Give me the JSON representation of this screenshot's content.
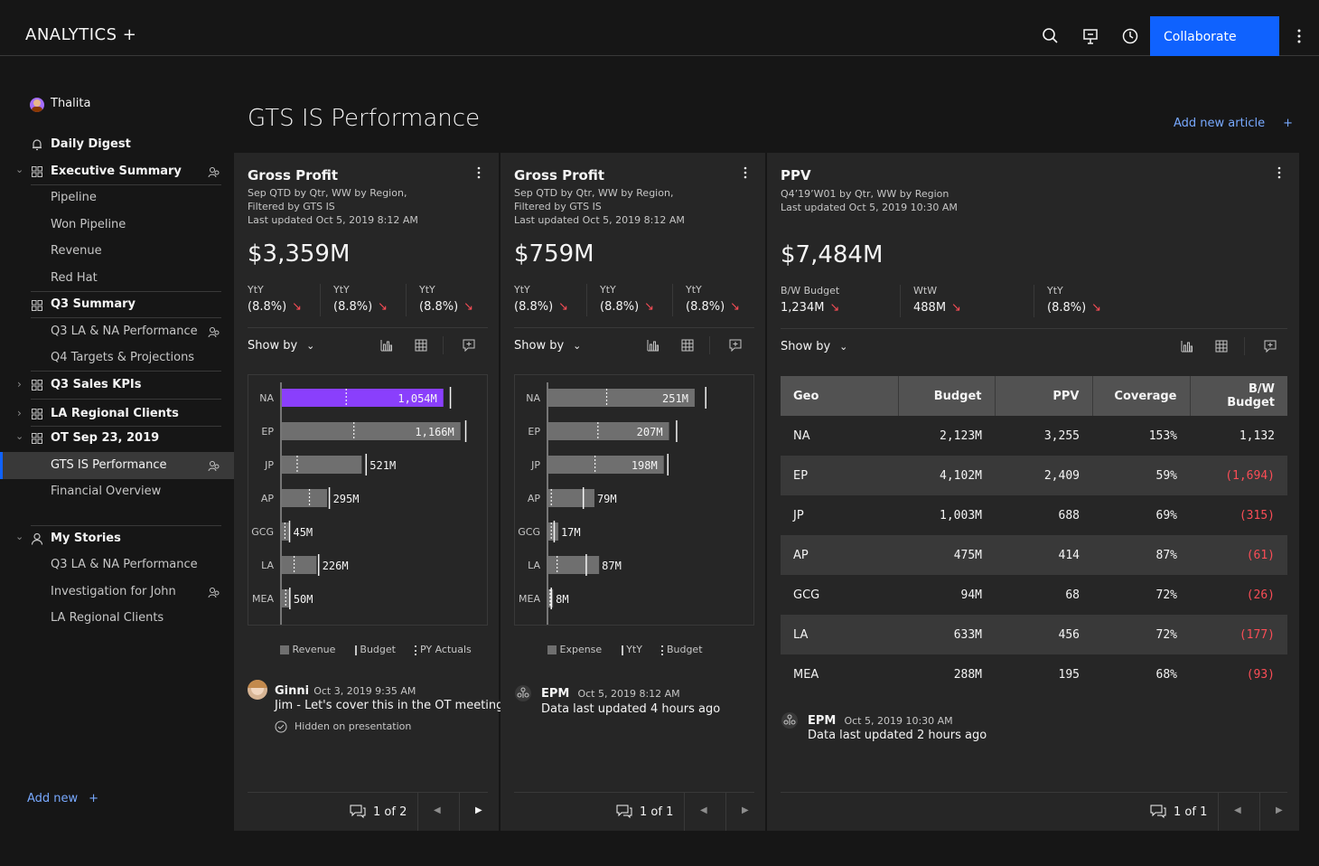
{
  "header": {
    "brand": "ANALYTICS +",
    "collaborate_label": "Collaborate"
  },
  "sidebar": {
    "user": "Thalita",
    "items": [
      {
        "label": "Daily Digest"
      },
      {
        "label": "Executive Summary"
      },
      {
        "label": "Pipeline"
      },
      {
        "label": "Won Pipeline"
      },
      {
        "label": "Revenue"
      },
      {
        "label": "Red Hat"
      },
      {
        "label": "Q3 Summary"
      },
      {
        "label": "Q3 LA & NA Performance"
      },
      {
        "label": "Q4 Targets & Projections"
      },
      {
        "label": "Q3 Sales KPIs"
      },
      {
        "label": "LA Regional Clients"
      },
      {
        "label": "OT Sep 23, 2019"
      },
      {
        "label": "GTS IS Performance"
      },
      {
        "label": "Financial Overview"
      },
      {
        "label": "My Stories"
      },
      {
        "label": "Q3 LA & NA Performance"
      },
      {
        "label": "Investigation for John"
      },
      {
        "label": "LA Regional Clients"
      }
    ],
    "add_new": "Add new"
  },
  "main": {
    "title": "GTS IS Performance",
    "add_article": "Add new article"
  },
  "cards": [
    {
      "title": "Gross Profit",
      "sub1": "Sep QTD by Qtr, WW by Region,",
      "sub2": "Filtered by GTS IS",
      "sub3": "Last updated Oct 5, 2019 8:12 AM",
      "big": "$3,359M",
      "metrics": [
        {
          "label": "YtY",
          "value": "(8.8%)"
        },
        {
          "label": "YtY",
          "value": "(8.8%)"
        },
        {
          "label": "YtY",
          "value": "(8.8%)"
        }
      ],
      "show_by": "Show by",
      "legend": [
        "Revenue",
        "Budget",
        "PY Actuals"
      ],
      "comment": {
        "name": "Ginni",
        "time": "Oct 3, 2019 9:35 AM",
        "text": "Jim - Let's cover this in the OT meeting",
        "note": "Hidden on presentation"
      },
      "pager": "1 of 2"
    },
    {
      "title": "Gross Profit",
      "sub1": "Sep QTD by Qtr, WW by Region,",
      "sub2": "Filtered by GTS IS",
      "sub3": "Last updated Oct 5, 2019 8:12 AM",
      "big": "$759M",
      "metrics": [
        {
          "label": "YtY",
          "value": "(8.8%)"
        },
        {
          "label": "YtY",
          "value": "(8.8%)"
        },
        {
          "label": "YtY",
          "value": "(8.8%)"
        }
      ],
      "show_by": "Show by",
      "legend": [
        "Expense",
        "YtY",
        "Budget"
      ],
      "comment": {
        "name": "EPM",
        "time": "Oct 5, 2019 8:12 AM",
        "text": "Data last updated 4 hours ago"
      },
      "pager": "1 of 1"
    },
    {
      "title": "PPV",
      "sub1": "Q4’19’W01 by Qtr, WW by Region",
      "sub2": "Last updated Oct 5, 2019 10:30 AM",
      "big": "$7,484M",
      "metrics": [
        {
          "label": "B/W Budget",
          "value": "1,234M"
        },
        {
          "label": "WtW",
          "value": "488M"
        },
        {
          "label": "YtY",
          "value": "(8.8%)"
        }
      ],
      "show_by": "Show by",
      "table": {
        "headers": [
          "Geo",
          "Budget",
          "PPV",
          "Coverage",
          "B/W Budget"
        ],
        "rows": [
          [
            "NA",
            "2,123M",
            "3,255",
            "153%",
            "1,132"
          ],
          [
            "EP",
            "4,102M",
            "2,409",
            "59%",
            "(1,694)"
          ],
          [
            "JP",
            "1,003M",
            "688",
            "69%",
            "(315)"
          ],
          [
            "AP",
            "475M",
            "414",
            "87%",
            "(61)"
          ],
          [
            "GCG",
            "94M",
            "68",
            "72%",
            "(26)"
          ],
          [
            "LA",
            "633M",
            "456",
            "72%",
            "(177)"
          ],
          [
            "MEA",
            "288M",
            "195",
            "68%",
            "(93)"
          ]
        ]
      },
      "comment": {
        "name": "EPM",
        "time": "Oct 5, 2019 10:30 AM",
        "text": "Data last updated 2 hours ago"
      },
      "pager": "1 of 1"
    }
  ],
  "chart_data": [
    {
      "type": "bar",
      "categories": [
        "NA",
        "EP",
        "JP",
        "AP",
        "GCG",
        "LA",
        "MEA"
      ],
      "series": [
        {
          "name": "Revenue",
          "values": [
            1054,
            1166,
            521,
            295,
            45,
            226,
            50
          ],
          "labels": [
            "1,054M",
            "1,166M",
            "521M",
            "295M",
            "45M",
            "226M",
            "50M"
          ]
        },
        {
          "name": "Budget",
          "values": [
            1100,
            1200,
            550,
            310,
            50,
            240,
            52
          ]
        },
        {
          "name": "PY Actuals",
          "values": [
            420,
            470,
            100,
            180,
            20,
            80,
            25
          ]
        }
      ],
      "highlight": "NA",
      "colors": {
        "highlight": "#8a3ffc",
        "bar": "#6f6f6f"
      }
    },
    {
      "type": "bar",
      "categories": [
        "NA",
        "EP",
        "JP",
        "AP",
        "GCG",
        "LA",
        "MEA"
      ],
      "series": [
        {
          "name": "Expense",
          "values": [
            251,
            207,
            198,
            79,
            17,
            87,
            8
          ],
          "labels": [
            "251M",
            "207M",
            "198M",
            "79M",
            "17M",
            "87M",
            "8M"
          ]
        },
        {
          "name": "YtY",
          "values": [
            270,
            220,
            205,
            60,
            10,
            65,
            5
          ]
        },
        {
          "name": "Budget",
          "values": [
            100,
            85,
            80,
            5,
            5,
            15,
            3
          ]
        }
      ],
      "colors": {
        "bar": "#6f6f6f"
      }
    }
  ]
}
